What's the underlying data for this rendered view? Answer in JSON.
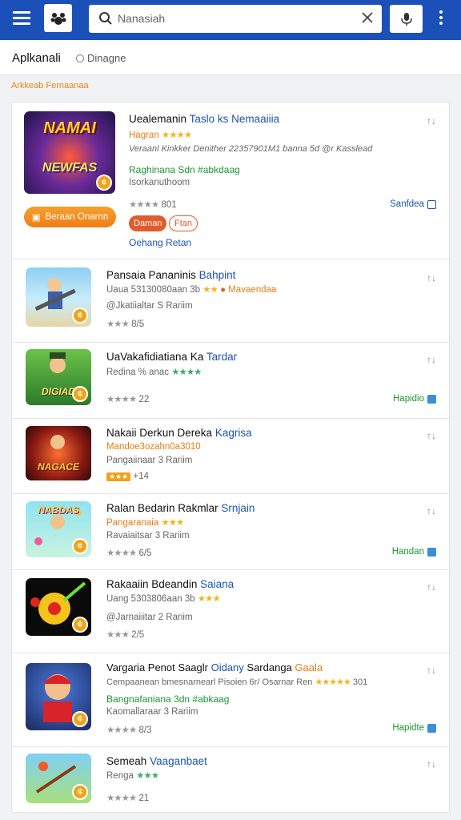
{
  "topbar": {
    "search_placeholder": "Nanasiah",
    "accent": "#1b50b8"
  },
  "tabs": {
    "main_label": "Aplkanali",
    "radio_label": "Dinagne"
  },
  "section_label": "Arkkeab Fernaanaa",
  "items": [
    {
      "title": "Uealemanin",
      "title_hl": "Taslo ks Nemaaiiia",
      "line1_text": "Hagran",
      "line1_stars": "★★★★",
      "line2": "Veraanl Kinkker Denither 22357901M1 banna 5d @r Kasslead",
      "line3_green": "Raghinana Sdn #abkdaag",
      "line4": "Isorkanuthoom",
      "line5_stars": "★★★★",
      "line5_text": "801",
      "right_tag": "Sanfdea",
      "button_label": "Beraan Onarnn",
      "chip_red": "Daman",
      "chip_outline": "Ftan",
      "link": "Oehang Retan",
      "thumb_label": "NEWFAS"
    },
    {
      "title": "Pansaia Pananinis",
      "title_hl": "Bahpint",
      "line1_text": "Uaua 53130080aan 3b",
      "line1_stars": "★★",
      "line1_tail": "Mavaendaa",
      "line2": "@Jkatiialtar S Rariim",
      "line3_stars": "★★★",
      "line3_text": "8/5"
    },
    {
      "title": "UaVakafidiatiana Ka",
      "title_hl": "Tardar",
      "line1_text": "Redina % anac",
      "line1_stars": "★★★★",
      "line3_stars": "★★★★",
      "line3_text": "22",
      "right_tag": "Hapidio",
      "thumb_label": "DIGIAD"
    },
    {
      "title": "Nakaii Derkun Dereka",
      "title_hl": "Kagrisa",
      "line1_text": "Mandoe3ozahn0a3010",
      "line2": "Pangaiinaar 3 Rariim",
      "line3_text": "+14",
      "thumb_label": "NAGACE"
    },
    {
      "title": "Ralan Bedarin Rakmlar",
      "title_hl": "Srnjain",
      "line1_text": "Pangaranaia",
      "line1_stars": "★★★",
      "line2": "Ravaiaitsar 3 Rariim",
      "line3_stars": "★★★★",
      "line3_text": "6/5",
      "right_tag": "Handan",
      "thumb_label": "NABDAS"
    },
    {
      "title": "Rakaaiin Bdeandin",
      "title_hl": "Saiana",
      "line1_text": "Uang 5303806aan 3b",
      "line1_stars": "★★★",
      "line2": "@Jarnaiiitar 2 Rariim",
      "line3_stars": "★★★",
      "line3_text": "2/5"
    },
    {
      "title": "Vargaria Penot Saaglr",
      "title_hl": "Oidany",
      "title_tail": "Sardanga",
      "title_tail2": "Gaala",
      "line1_text": "Cempaanean bmesnarnearl Pisoien 6r/ Osarnar Ren",
      "line1_stars": "★★★★★",
      "line1_tail": "301",
      "line2_green": "Bangnafaniana 3dn #abkaag",
      "line3": "Kaomallaraar 3 Rariim",
      "line4_stars": "★★★★",
      "line4_text": "8/3",
      "right_tag": "Hapidte"
    },
    {
      "title": "Semeah",
      "title_hl": "Vaaganbaet",
      "line1_text": "Renga",
      "line1_stars": "★★★",
      "line3_stars": "★★★★",
      "line3_text": "21"
    }
  ]
}
